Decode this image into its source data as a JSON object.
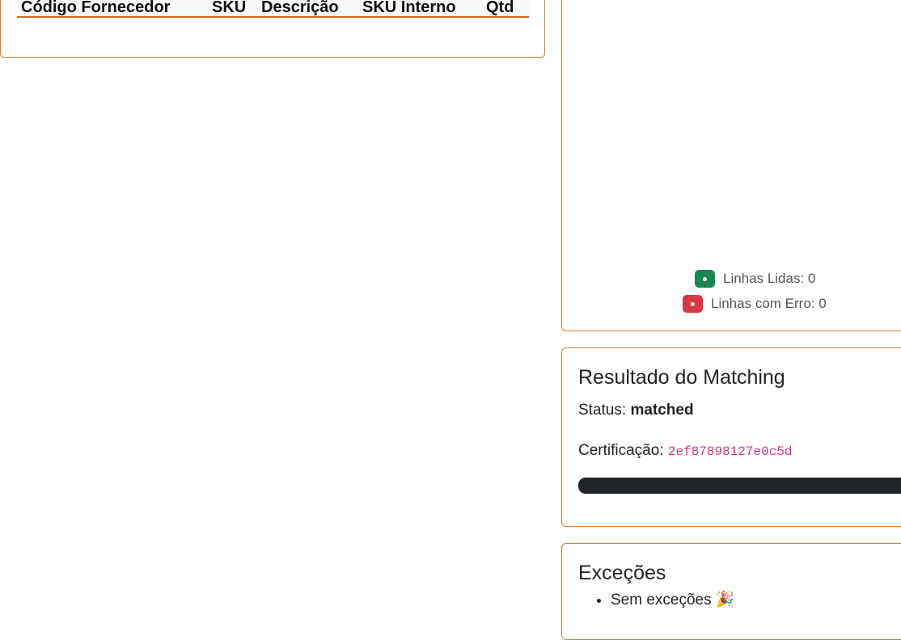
{
  "table": {
    "columns": [
      "Código Fornecedor",
      "SKU",
      "Descrição",
      "SKU Interno",
      "Qtd"
    ]
  },
  "summary": {
    "read_label": "Linhas Lidas: 0",
    "error_label": "Linhas com Erro: 0",
    "read_color": "#198754",
    "error_color": "#dc3545"
  },
  "matching": {
    "title": "Resultado do Matching",
    "status_label": "Status:",
    "status_value": "matched",
    "cert_label": "Certificação:",
    "cert_value": "2ef87898127e0c5d",
    "progress_fraction": 1.0
  },
  "exceptions": {
    "title": "Exceções",
    "items": [
      "Sem exceções 🎉"
    ]
  }
}
